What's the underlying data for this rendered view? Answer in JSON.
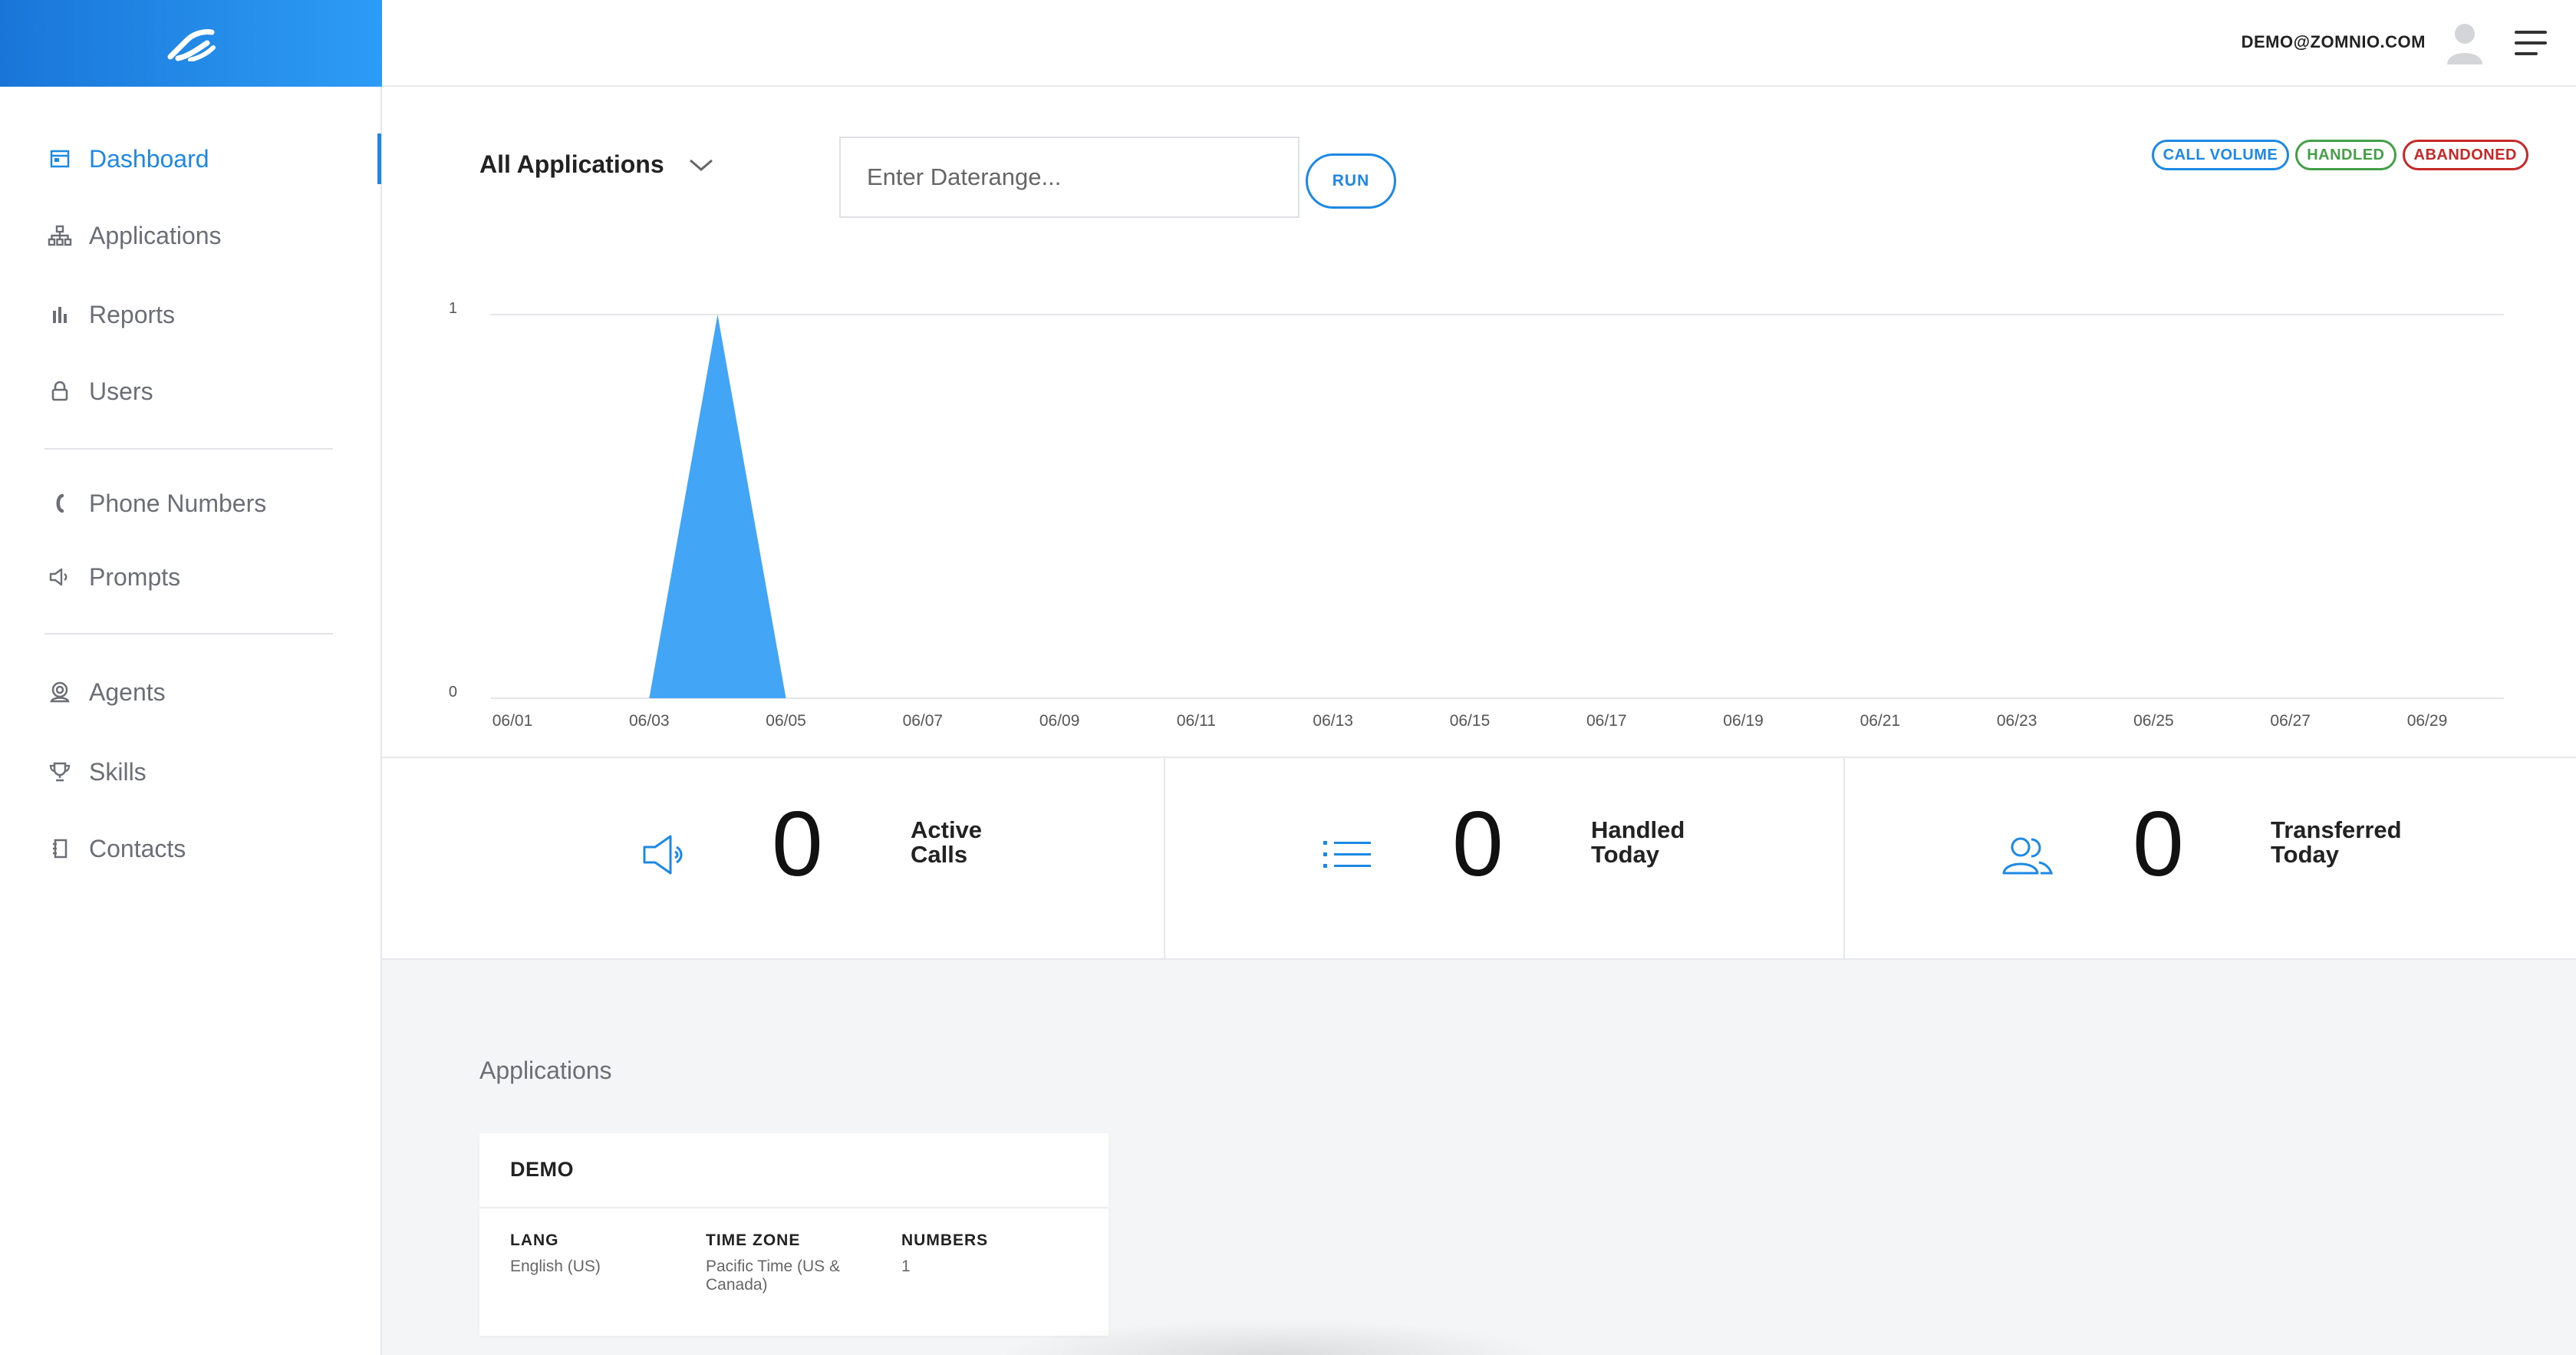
{
  "header": {
    "user_email": "DEMO@ZOMNIO.COM"
  },
  "sidebar": {
    "items": [
      {
        "label": "Dashboard",
        "icon": "calendar-icon",
        "active": true
      },
      {
        "label": "Applications",
        "icon": "sitemap-icon"
      },
      {
        "label": "Reports",
        "icon": "bar-chart-icon"
      },
      {
        "label": "Users",
        "icon": "lock-icon"
      },
      {
        "label": "Phone Numbers",
        "icon": "phone-icon"
      },
      {
        "label": "Prompts",
        "icon": "speaker-icon"
      },
      {
        "label": "Agents",
        "icon": "headset-icon"
      },
      {
        "label": "Skills",
        "icon": "trophy-icon"
      },
      {
        "label": "Contacts",
        "icon": "address-book-icon"
      }
    ]
  },
  "toolbar": {
    "app_select": "All Applications",
    "daterange_placeholder": "Enter Daterange...",
    "run_label": "RUN"
  },
  "legend": [
    {
      "label": "CALL VOLUME",
      "color": "#1e88e5"
    },
    {
      "label": "HANDLED",
      "color": "#43a047"
    },
    {
      "label": "ABANDONED",
      "color": "#c62828"
    }
  ],
  "chart_data": {
    "type": "area",
    "x": [
      "06/01",
      "06/02",
      "06/03",
      "06/04",
      "06/05",
      "06/06",
      "06/07",
      "06/08",
      "06/09",
      "06/10",
      "06/11",
      "06/12",
      "06/13",
      "06/14",
      "06/15",
      "06/16",
      "06/17",
      "06/18",
      "06/19",
      "06/20",
      "06/21",
      "06/22",
      "06/23",
      "06/24",
      "06/25",
      "06/26",
      "06/27",
      "06/28",
      "06/29",
      "06/30"
    ],
    "tick_labels": [
      "06/01",
      "06/03",
      "06/05",
      "06/07",
      "06/09",
      "06/11",
      "06/13",
      "06/15",
      "06/17",
      "06/19",
      "06/21",
      "06/23",
      "06/25",
      "06/27",
      "06/29"
    ],
    "series": [
      {
        "name": "CALL VOLUME",
        "color": "#42a5f5",
        "values": [
          0,
          0,
          0,
          1,
          0,
          0,
          0,
          0,
          0,
          0,
          0,
          0,
          0,
          0,
          0,
          0,
          0,
          0,
          0,
          0,
          0,
          0,
          0,
          0,
          0,
          0,
          0,
          0,
          0,
          0
        ]
      }
    ],
    "y_ticks": [
      "0",
      "1"
    ],
    "ylim": [
      0,
      1
    ],
    "grid": true
  },
  "stats": [
    {
      "value": "0",
      "label_line1": "Active",
      "label_line2": "Calls",
      "icon": "speaker-icon"
    },
    {
      "value": "0",
      "label_line1": "Handled",
      "label_line2": "Today",
      "icon": "list-icon"
    },
    {
      "value": "0",
      "label_line1": "Transferred",
      "label_line2": "Today",
      "icon": "users-icon"
    }
  ],
  "applications": {
    "heading": "Applications",
    "cards": [
      {
        "title": "DEMO",
        "fields": [
          {
            "label": "LANG",
            "value": "English (US)"
          },
          {
            "label": "TIME ZONE",
            "value": "Pacific Time (US & Canada)"
          },
          {
            "label": "NUMBERS",
            "value": "1"
          }
        ]
      }
    ]
  },
  "colors": {
    "accent": "#1e88e5",
    "chart_fill": "#42a5f5",
    "handled": "#43a047",
    "abandoned": "#c62828"
  }
}
